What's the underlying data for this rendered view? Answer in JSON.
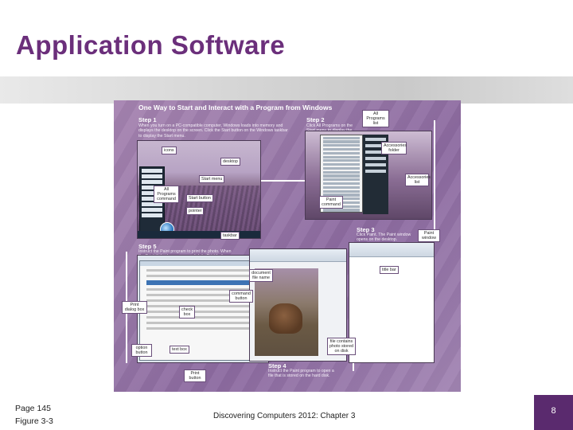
{
  "slide": {
    "title": "Application Software",
    "page_ref": "Page 145",
    "figure_ref": "Figure 3-3",
    "footer": "Discovering Computers 2012: Chapter 3",
    "slide_number": "8"
  },
  "figure": {
    "heading": "One Way to Start and Interact with a Program from Windows",
    "steps": [
      {
        "title": "Step 1",
        "text": "When you turn on a PC-compatible computer, Windows loads into memory and displays the desktop on the screen. Click the Start button on the Windows taskbar to display the Start menu."
      },
      {
        "title": "Step 2",
        "text": "Click All Programs on the Start menu to display the All Programs list. Click Accessories in the All Programs list and then point to Paint in the Accessories list."
      },
      {
        "title": "Step 3",
        "text": "Click Paint. The Paint window opens on the desktop."
      },
      {
        "title": "Step 4",
        "text": "Instruct the Paint program to open a file that is stored on the hard disk."
      },
      {
        "title": "Step 5",
        "text": "Instruct the Paint program to print the photo. When the Print dialog box appears, click its Print button."
      }
    ],
    "callouts": {
      "icons": "icons",
      "desktop": "desktop",
      "start_menu": "Start menu",
      "all_programs_command": "All Programs command",
      "start_button": "Start button",
      "pointer": "pointer",
      "taskbar": "taskbar",
      "all_programs_list": "All Programs list",
      "accessories_folder": "Accessories folder",
      "accessories_list": "Accessories list",
      "paint_command": "Paint command",
      "paint_window": "Paint window",
      "title_bar": "title bar",
      "document_file_name": "document file name",
      "command_button": "command button",
      "print_dialog_box": "Print dialog box",
      "check_box": "check box",
      "option_button": "option button",
      "text_box": "text box",
      "print_button": "Print button",
      "file_contains_photo": "file contains photo stored on disk"
    }
  }
}
